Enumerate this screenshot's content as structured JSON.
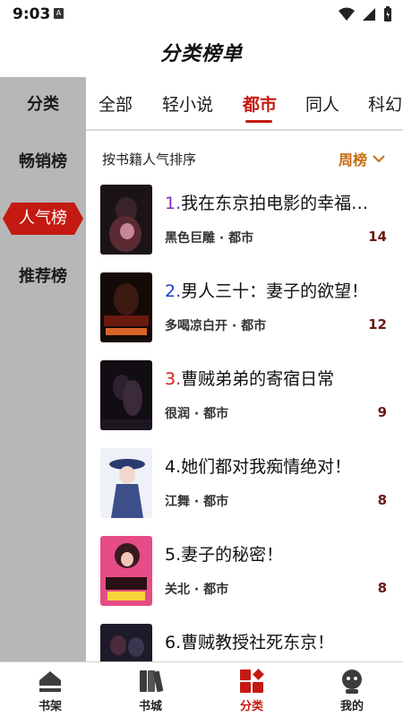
{
  "status": {
    "time": "9:03",
    "notif_letter": "A"
  },
  "header": {
    "title": "分类榜单"
  },
  "left_nav": {
    "items": [
      {
        "label": "分类",
        "active": false
      },
      {
        "label": "畅销榜",
        "active": false
      },
      {
        "label": "人气榜",
        "active": true
      },
      {
        "label": "推荐榜",
        "active": false
      }
    ]
  },
  "category_tabs": [
    {
      "label": "全部",
      "active": false
    },
    {
      "label": "轻小说",
      "active": false
    },
    {
      "label": "都市",
      "active": true
    },
    {
      "label": "同人",
      "active": false
    },
    {
      "label": "科幻",
      "active": false
    }
  ],
  "sort": {
    "label": "按书籍人气排序",
    "period": "周榜"
  },
  "books": [
    {
      "rank": "1.",
      "title": "我在东京拍电影的幸福…",
      "meta": "黑色巨雕 · 都市",
      "count": "14",
      "rank_color": "#7b2fbf"
    },
    {
      "rank": "2.",
      "title": "男人三十：妻子的欲望！",
      "meta": "多喝凉白开 · 都市",
      "count": "12",
      "rank_color": "#1f3fd1"
    },
    {
      "rank": "3.",
      "title": "曹贼弟弟的寄宿日常",
      "meta": "很润 · 都市",
      "count": "9",
      "rank_color": "#d4210f"
    },
    {
      "rank": "4.",
      "title": "她们都对我痴情绝对！",
      "meta": "江舞 · 都市",
      "count": "8",
      "rank_color": "#111111"
    },
    {
      "rank": "5.",
      "title": "妻子的秘密！",
      "meta": "关北 · 都市",
      "count": "8",
      "rank_color": "#111111"
    },
    {
      "rank": "6.",
      "title": "曹贼教授社死东京！",
      "meta": "",
      "count": "",
      "rank_color": "#111111"
    }
  ],
  "bottom_nav": [
    {
      "label": "书架",
      "icon": "bookshelf-icon",
      "active": false
    },
    {
      "label": "书城",
      "icon": "bookstore-icon",
      "active": false
    },
    {
      "label": "分类",
      "icon": "category-icon",
      "active": true
    },
    {
      "label": "我的",
      "icon": "profile-icon",
      "active": false
    }
  ],
  "colors": {
    "accent": "#c41a12",
    "sidebar": "#b7b7b7",
    "period": "#c76b12"
  }
}
